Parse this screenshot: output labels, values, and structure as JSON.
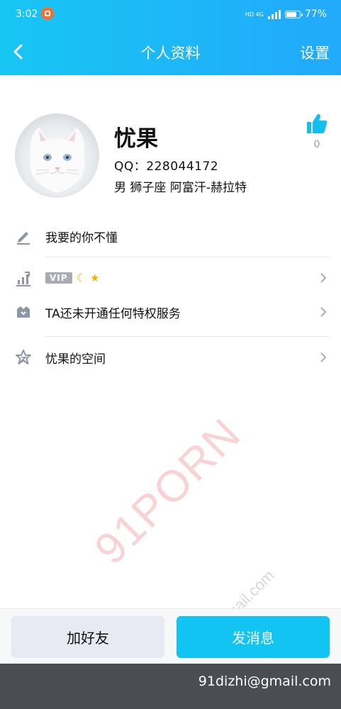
{
  "status_bar": {
    "time": "3:02",
    "network": "HD 4G",
    "battery": "77%"
  },
  "nav": {
    "title": "个人资料",
    "settings": "设置"
  },
  "profile": {
    "name": "忧果",
    "qq": "QQ：228044172",
    "meta": "男  狮子座  阿富汗-赫拉特",
    "likes": "0"
  },
  "rows": {
    "signature": "我要的你不懂",
    "vip_tag": "VIP",
    "privilege": "TA还未开通任何特权服务",
    "space": "忧果的空间"
  },
  "actions": {
    "add_friend": "加好友",
    "send_message": "发消息"
  },
  "watermark": {
    "main": "91PORN",
    "secondary": "91dizhi@gmail.com"
  },
  "footer": {
    "email": "91dizhi@gmail.com"
  },
  "colors": {
    "header_start": "#17c6f3",
    "header_end": "#22a9fb",
    "primary_button": "#12c4f2",
    "icon_gray": "#8e96a6"
  }
}
